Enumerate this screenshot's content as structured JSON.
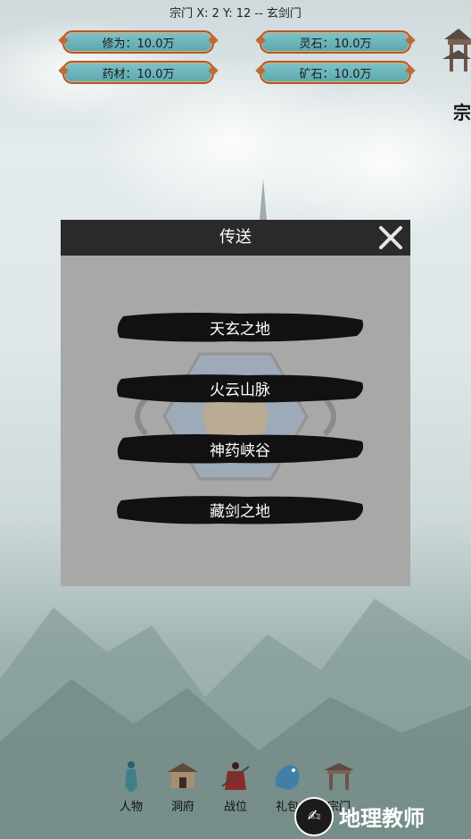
{
  "header": {
    "location": "宗门 X:  2 Y:  12 -- 玄剑门"
  },
  "resources": [
    {
      "label": "修为：10.0万"
    },
    {
      "label": "灵石：10.0万"
    },
    {
      "label": "药材：10.0万"
    },
    {
      "label": "矿石：10.0万"
    }
  ],
  "side": {
    "sect_label": "宗"
  },
  "modal": {
    "title": "传送",
    "destinations": [
      {
        "label": "天玄之地"
      },
      {
        "label": "火云山脉"
      },
      {
        "label": "神药峡谷"
      },
      {
        "label": "藏剑之地"
      }
    ]
  },
  "nav": [
    {
      "label": "人物",
      "icon": "character-icon"
    },
    {
      "label": "洞府",
      "icon": "cave-dwelling-icon"
    },
    {
      "label": "战位",
      "icon": "battle-position-icon"
    },
    {
      "label": "礼包",
      "icon": "gift-pack-icon"
    },
    {
      "label": "宗门",
      "icon": "sect-icon"
    }
  ],
  "watermark": {
    "text": "地理教师"
  }
}
